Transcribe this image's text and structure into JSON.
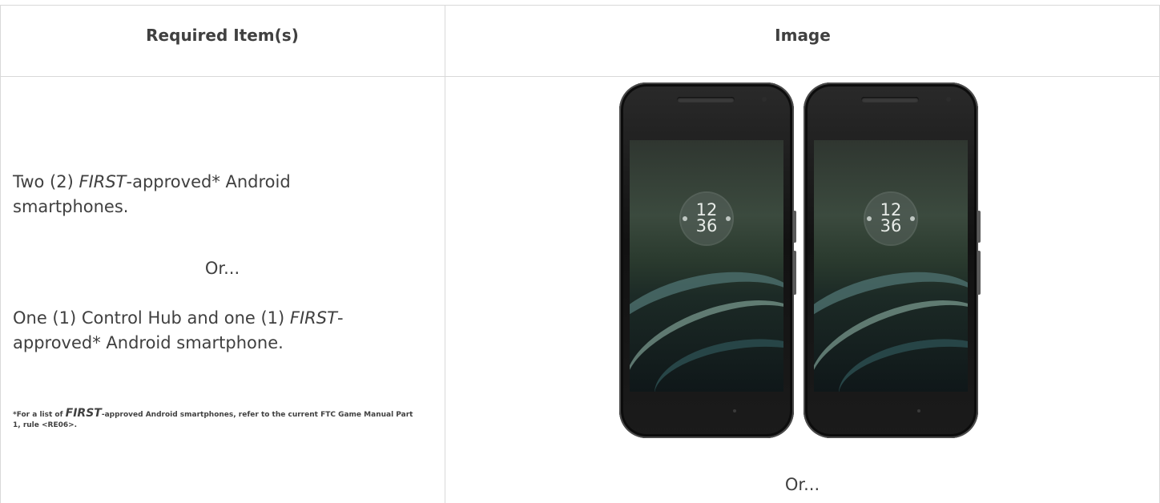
{
  "table": {
    "headers": {
      "col1": "Required Item(s)",
      "col2": "Image"
    },
    "left_cell": {
      "line1_pre": "Two (2) ",
      "line1_first": "FIRST",
      "line1_post": "-approved* Android",
      "line1_cont": "smartphones.",
      "or_text": "Or...",
      "line2_a": "One (1) Control Hub and one (1) ",
      "line2_first": "FIRST",
      "line2_dash": "-",
      "line2_b": "approved* Android smartphone.",
      "footnote_pre": "*For a list of ",
      "footnote_first": "FIRST",
      "footnote_post": "-approved Android smartphones, refer to the current FTC Game Manual Part",
      "footnote_line2": "1, rule <RE06>."
    },
    "right_cell": {
      "phone_clock_hour": "12",
      "phone_clock_minute": "36",
      "or_text": "Or..."
    }
  },
  "colors": {
    "border": "#d9d9d9",
    "text": "#404040"
  }
}
